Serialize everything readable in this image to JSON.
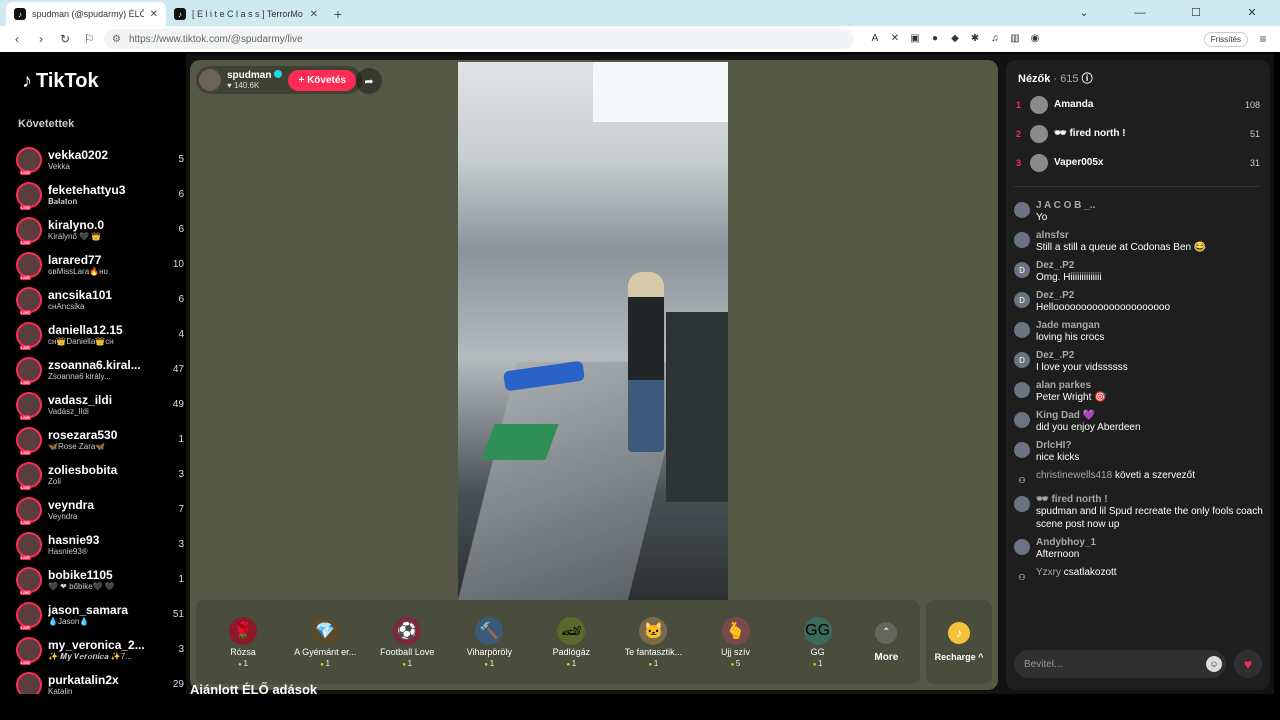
{
  "browser": {
    "tabs": [
      {
        "title": "spudman (@spudarmy) ÉLŐ a",
        "icon": "tiktok-icon",
        "active": true
      },
      {
        "title": "[ E l i t e   C l a s s ] TerrorMo",
        "icon": "tiktok-icon",
        "active": false
      }
    ],
    "new_tab": "+",
    "url": "https://www.tiktok.com/@spudarmy/live",
    "refresh_label": "Frissítés"
  },
  "sidebar": {
    "logo": "TikTok",
    "following_header": "Követettek",
    "following": [
      {
        "name": "vekka0202",
        "sub": "Vekka",
        "count": "5"
      },
      {
        "name": "feketehattyu3",
        "sub": "𝐁𝐚𝐥𝐚𝐭𝐨𝐧",
        "count": "6"
      },
      {
        "name": "kiralyno.0",
        "sub": "Királynő 🖤 👑",
        "count": "6"
      },
      {
        "name": "larared77",
        "sub": "ɢʙMissLara🔥ʜᴜ",
        "count": "10"
      },
      {
        "name": "ancsika101",
        "sub": "ᴄʜAncsika",
        "count": "6"
      },
      {
        "name": "daniella12.15",
        "sub": "ᴄʜ👑Daniella👑ᴄʜ",
        "count": "4"
      },
      {
        "name": "zsoanna6.kiral...",
        "sub": "Zsoanna6 király...",
        "count": "47"
      },
      {
        "name": "vadasz_ildi",
        "sub": "Vadász_Ildi",
        "count": "49"
      },
      {
        "name": "rosezara530",
        "sub": "🦋Rose Zara🦋",
        "count": "1"
      },
      {
        "name": "zoliesbobita",
        "sub": "Zoli",
        "count": "3"
      },
      {
        "name": "veyndra",
        "sub": "Veyndra",
        "count": "7"
      },
      {
        "name": "hasnie93",
        "sub": "Hasnie93®",
        "count": "3"
      },
      {
        "name": "bobike1105",
        "sub": "🖤 ❤ bőbike🖤 🖤",
        "count": "1"
      },
      {
        "name": "jason_samara",
        "sub": "💧Jason💧",
        "count": "51"
      },
      {
        "name": "my_veronica_2...",
        "sub": "✨ 𝑴𝒚 𝑽𝒆𝒓𝒐𝒏𝒊𝒄𝒂 ✨7...",
        "count": "3"
      },
      {
        "name": "purkatalin2x",
        "sub": "Katalin",
        "count": "29"
      }
    ]
  },
  "stage": {
    "host_name": "spudman",
    "host_likes": "♥ 140.6K",
    "follow_label": "+ Követés",
    "gifts": [
      {
        "name": "Rózsa",
        "coins": "1",
        "icon": "🌹",
        "bg": "#8b1a2a"
      },
      {
        "name": "A Gyémánt er...",
        "coins": "1",
        "icon": "💎",
        "bg": "#5a4a2a"
      },
      {
        "name": "Football Love",
        "coins": "1",
        "icon": "⚽",
        "bg": "#7a2a3a"
      },
      {
        "name": "Viharpöröly",
        "coins": "1",
        "icon": "🔨",
        "bg": "#3a5a7a"
      },
      {
        "name": "Padlógáz",
        "coins": "1",
        "icon": "🏎",
        "bg": "#5a6a2a"
      },
      {
        "name": "Te fantasztik...",
        "coins": "1",
        "icon": "🐱",
        "bg": "#7a6a4a"
      },
      {
        "name": "Ujj szív",
        "coins": "5",
        "icon": "🫰",
        "bg": "#7a4a4a"
      },
      {
        "name": "GG",
        "coins": "1",
        "icon": "GG",
        "bg": "#3a6a5a"
      }
    ],
    "more_label": "More",
    "recharge_label": "Recharge ^"
  },
  "recommended_header": "Ajánlott ÉLŐ adások",
  "chat": {
    "viewers_label": "Nézők",
    "viewers_count": "· 615",
    "top_viewers": [
      {
        "rank": "1",
        "name": "Amanda",
        "score": "108"
      },
      {
        "rank": "2",
        "name": "🕶 fired north !",
        "score": "51"
      },
      {
        "rank": "3",
        "name": "Vaper005x",
        "score": "31"
      }
    ],
    "messages": [
      {
        "user": "J A C O B _..",
        "text": "Yo",
        "avatar": ""
      },
      {
        "user": "alnsfsr",
        "text": "Still a still a queue at Codonas Ben 😂",
        "avatar": ""
      },
      {
        "user": "Dez_.P2",
        "text": "Omg. Hiiiiiiiiiiiiii",
        "avatar": "D"
      },
      {
        "user": "Dez_.P2",
        "text": "Hellooooooooooooooooooooo",
        "avatar": "D"
      },
      {
        "user": "Jade mangan",
        "text": "loving his crocs",
        "avatar": ""
      },
      {
        "user": "Dez_.P2",
        "text": "I love your vidssssss",
        "avatar": "D"
      },
      {
        "user": "alan parkes",
        "text": "Peter Wright 🎯",
        "avatar": ""
      },
      {
        "user": "King Dad 💜",
        "text": "did you enjoy Aberdeen",
        "avatar": ""
      },
      {
        "user": "DrlcHI?",
        "text": "nice kicks",
        "avatar": ""
      }
    ],
    "follow_notice": {
      "user": "christinewells418",
      "action": "követi a szervezőt"
    },
    "messages2": [
      {
        "user": "🕶 fired north !",
        "text": "spudman and lil Spud recreate the only fools coach scene post now up",
        "avatar": ""
      },
      {
        "user": "Andybhoy_1",
        "text": "Afternoon",
        "avatar": ""
      }
    ],
    "join_notice": {
      "user": "Yzxry",
      "action": "csatlakozott"
    },
    "input_placeholder": "Bevitel..."
  }
}
